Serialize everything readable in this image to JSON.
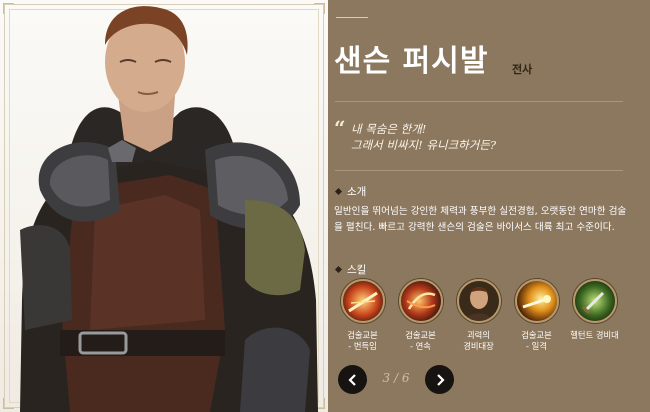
{
  "character": {
    "name": "샌슨 퍼시발",
    "class": "전사",
    "quote_line1": "내 목숨은 한개!",
    "quote_line2": "그래서 비싸지! 유니크하거든?"
  },
  "intro": {
    "heading": "소개",
    "text": "일반인을 뛰어넘는 강인한 체력과 풍부한 실전경험, 오랫동안 연마한 검술을 펼친다. 빠르고 강력한 샌슨의 검술은 바이서스 대륙 최고 수준이다."
  },
  "skills": {
    "heading": "스킬",
    "items": [
      {
        "line1": "검술교본",
        "line2": "- 번득임",
        "icon": "flash-slash-icon"
      },
      {
        "line1": "검술교본",
        "line2": "- 연속",
        "icon": "combo-slash-icon"
      },
      {
        "line1": "괴력의",
        "line2": "경비대장",
        "icon": "captain-portrait-icon"
      },
      {
        "line1": "검술교본",
        "line2": "- 일격",
        "icon": "strike-icon"
      },
      {
        "line1": "헬턴트 경비대",
        "line2": "",
        "icon": "guard-sword-icon"
      }
    ]
  },
  "pager": {
    "label": "3 / 6",
    "prev_icon": "chevron-left-icon",
    "next_icon": "chevron-right-icon"
  },
  "colors": {
    "panel": "#8c785f",
    "accent": "#2c2115",
    "nav": "#171310"
  }
}
